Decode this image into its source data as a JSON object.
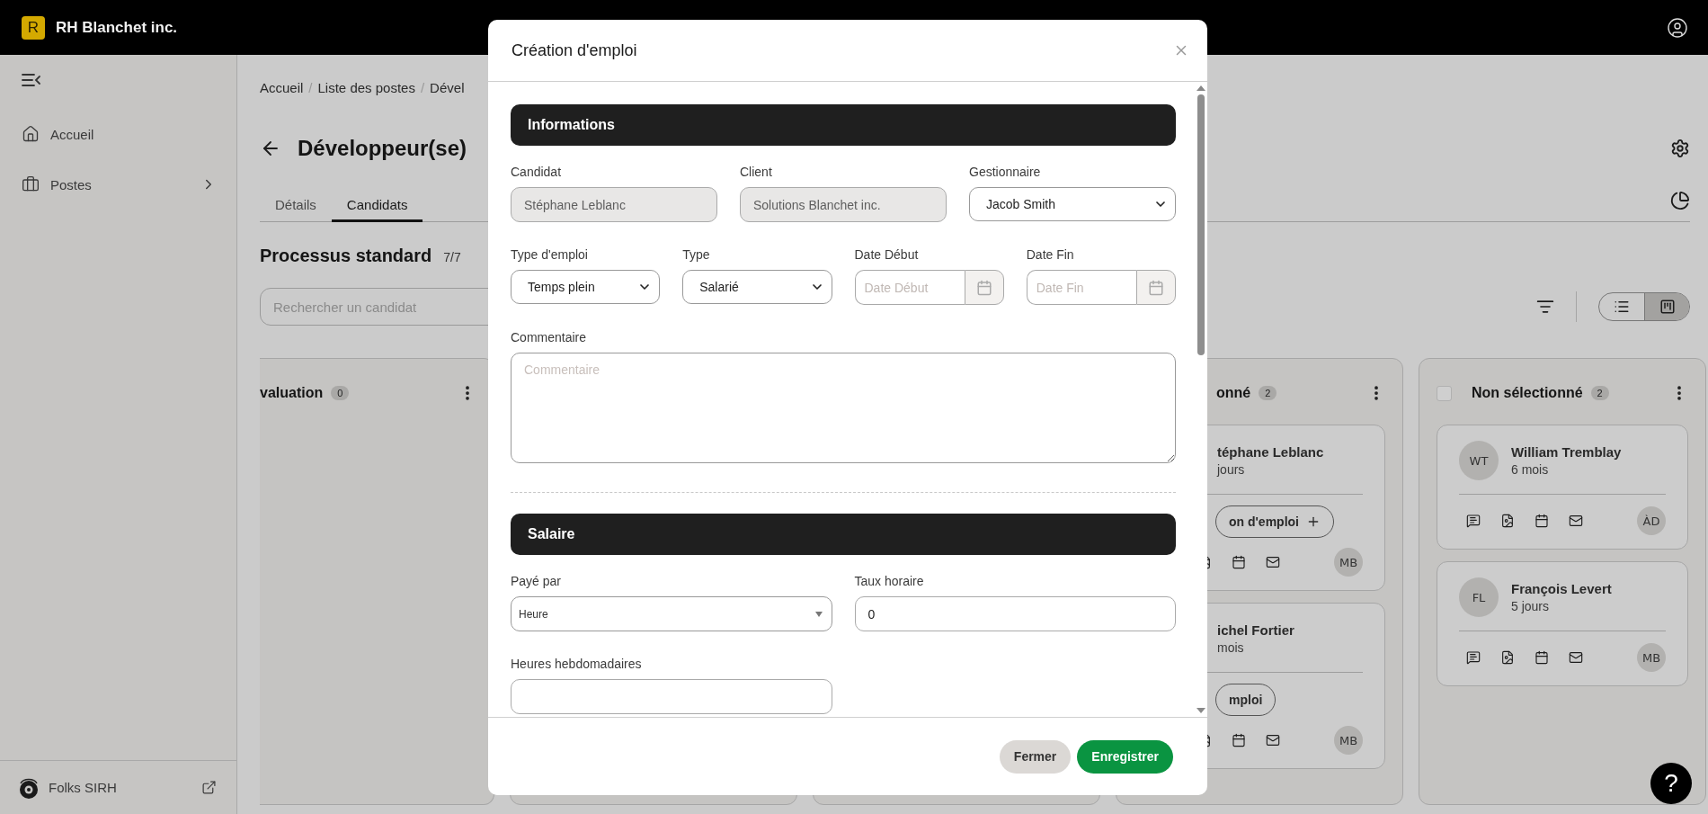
{
  "header": {
    "logo_letter": "R",
    "company": "RH Blanchet inc."
  },
  "sidebar": {
    "items": [
      {
        "label": "Accueil",
        "kind": "home",
        "expandable": false
      },
      {
        "label": "Postes",
        "kind": "briefcase",
        "expandable": true
      }
    ],
    "footer": {
      "label": "Folks SIRH"
    }
  },
  "breadcrumbs": [
    {
      "kind": "link",
      "label": "Accueil"
    },
    {
      "kind": "separator",
      "label": "/"
    },
    {
      "kind": "link",
      "label": "Liste des postes"
    },
    {
      "kind": "separator",
      "label": "/"
    },
    {
      "kind": "link",
      "label": "Dével"
    }
  ],
  "page_title": "Développeur(se)",
  "tabs": [
    {
      "label": "Détails",
      "selected": false
    },
    {
      "label": "Candidats",
      "selected": true
    }
  ],
  "process": {
    "title": "Processus standard",
    "count": "7/7"
  },
  "search": {
    "placeholder": "Rechercher un candidat"
  },
  "view_toggle": [
    {
      "kind": "list",
      "selected": false
    },
    {
      "kind": "board",
      "selected": true
    }
  ],
  "board": {
    "columns": [
      {
        "kind": "stage",
        "title": "valuation",
        "count": "0"
      },
      {
        "kind": "covered"
      },
      {
        "kind": "covered"
      },
      {
        "kind": "stage",
        "title": "onné",
        "count": "2",
        "cards": [
          {
            "name": "téphane Leblanc",
            "time": "jours",
            "action": {
              "label": "on d'emploi",
              "add": true
            },
            "owner": "MB"
          },
          {
            "name": "ichel Fortier",
            "time": "mois",
            "action": {
              "label": "mploi",
              "add": false
            },
            "owner": "MB"
          }
        ]
      },
      {
        "kind": "stage",
        "title": "Non sélectionné",
        "count": "2",
        "checkbox": {
          "checked": false
        },
        "cards": [
          {
            "initials": "WT",
            "name": "William Tremblay",
            "time": "6 mois",
            "owner": "ÀD"
          },
          {
            "initials": "FL",
            "name": "François Levert",
            "time": "5 jours",
            "owner": "MB"
          }
        ]
      }
    ]
  },
  "modal": {
    "title": "Création d'emploi",
    "sections": [
      {
        "title": "Informations",
        "rows": [
          [
            {
              "label": "Candidat",
              "kind": "text",
              "value": "Stéphane Leblanc",
              "disabled": true
            },
            {
              "label": "Client",
              "kind": "text",
              "value": "Solutions Blanchet inc.",
              "disabled": true
            },
            {
              "label": "Gestionnaire",
              "kind": "select",
              "value": "Jacob Smith"
            }
          ],
          [
            {
              "label": "Type d'emploi",
              "kind": "select",
              "value": "Temps plein"
            },
            {
              "label": "Type",
              "kind": "select",
              "value": "Salarié"
            },
            {
              "label": "Date Début",
              "kind": "date",
              "placeholder": "Date Début"
            },
            {
              "label": "Date Fin",
              "kind": "date",
              "placeholder": "Date Fin"
            }
          ],
          [
            {
              "label": "Commentaire",
              "kind": "textarea",
              "placeholder": "Commentaire"
            }
          ]
        ]
      },
      {
        "title": "Salaire",
        "rows": [
          [
            {
              "label": "Payé par",
              "kind": "dropdown",
              "value": "Heure"
            },
            {
              "label": "Taux horaire",
              "kind": "text",
              "value": "0",
              "disabled": false
            }
          ],
          [
            {
              "label": "Heures hebdomadaires",
              "kind": "text",
              "disabled": false
            }
          ]
        ]
      }
    ],
    "buttons": [
      {
        "label": "Fermer",
        "kind": "secondary"
      },
      {
        "label": "Enregistrer",
        "kind": "primary"
      }
    ]
  },
  "help": "?"
}
